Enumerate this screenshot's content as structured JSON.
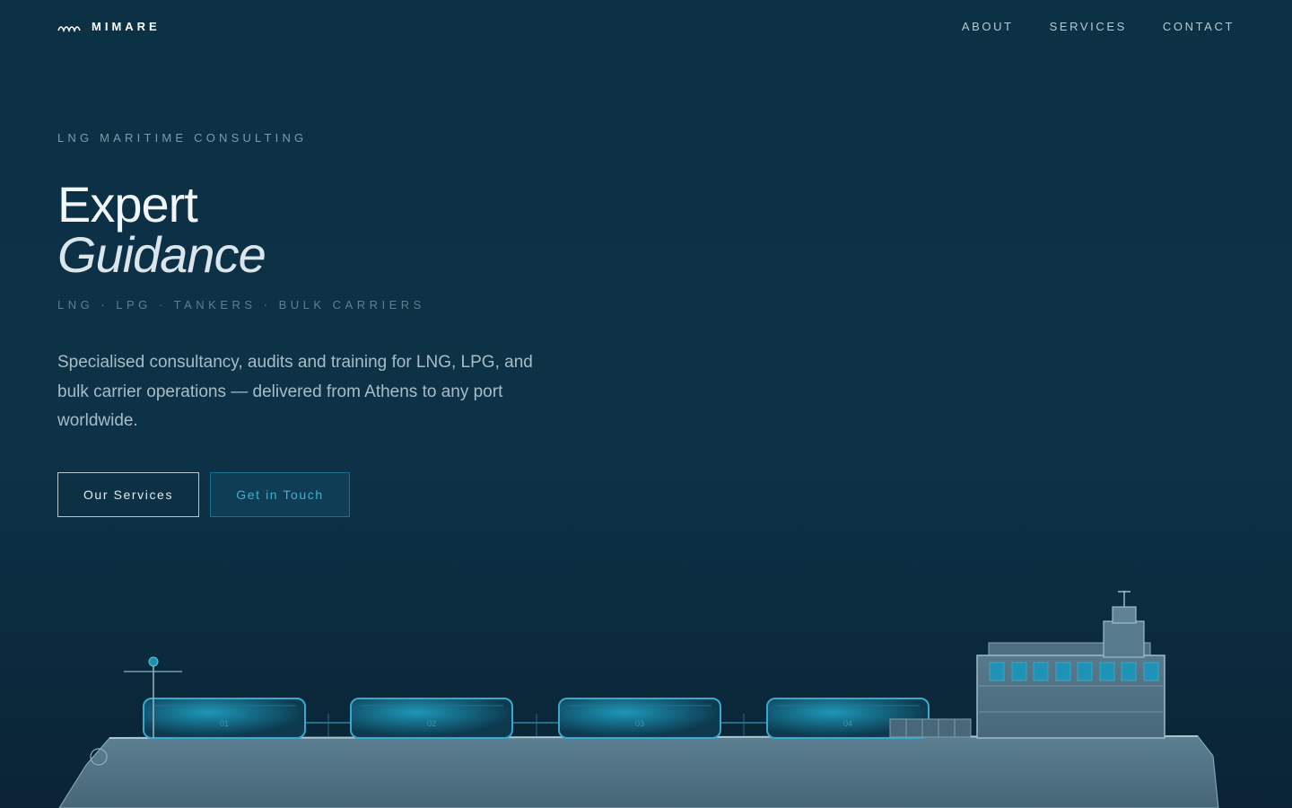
{
  "nav": {
    "brand": "MIMARE",
    "links": [
      "ABOUT",
      "SERVICES",
      "CONTACT"
    ]
  },
  "hero": {
    "eyebrow": "LNG MARITIME CONSULTING",
    "title_line1": "Expert",
    "title_line2": "Guidance",
    "tags": "LNG · LPG · TANKERS · BULK CARRIERS",
    "description": "Specialised consultancy, audits and training for LNG, LPG, and bulk carrier operations — delivered from Athens to any port worldwide.",
    "primary_button": "Our Services",
    "secondary_button": "Get in Touch"
  },
  "ship": {
    "tank_labels": [
      "01",
      "02",
      "03",
      "04"
    ]
  },
  "colors": {
    "background": "#0c3044",
    "accent": "#3ab2d6",
    "hull": "#5a7d90"
  },
  "icons": {
    "logo": "wave-icon"
  }
}
